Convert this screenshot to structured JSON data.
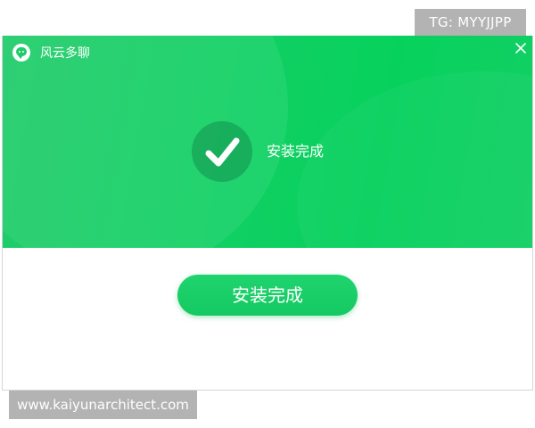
{
  "watermarks": {
    "top_right": "TG: MYYJJPP",
    "bottom_left": "www.kaiyunarchitect.com"
  },
  "window": {
    "title": "风云多聊",
    "close_icon": "close-icon",
    "logo_icon": "chat-bubble-icon"
  },
  "banner": {
    "status_icon": "check-icon",
    "status_text": "安装完成"
  },
  "actions": {
    "finish_label": "安装完成"
  },
  "colors": {
    "accent": "#12d064",
    "button": "#1fd46e",
    "watermark_bg": "#b3b3b3"
  }
}
